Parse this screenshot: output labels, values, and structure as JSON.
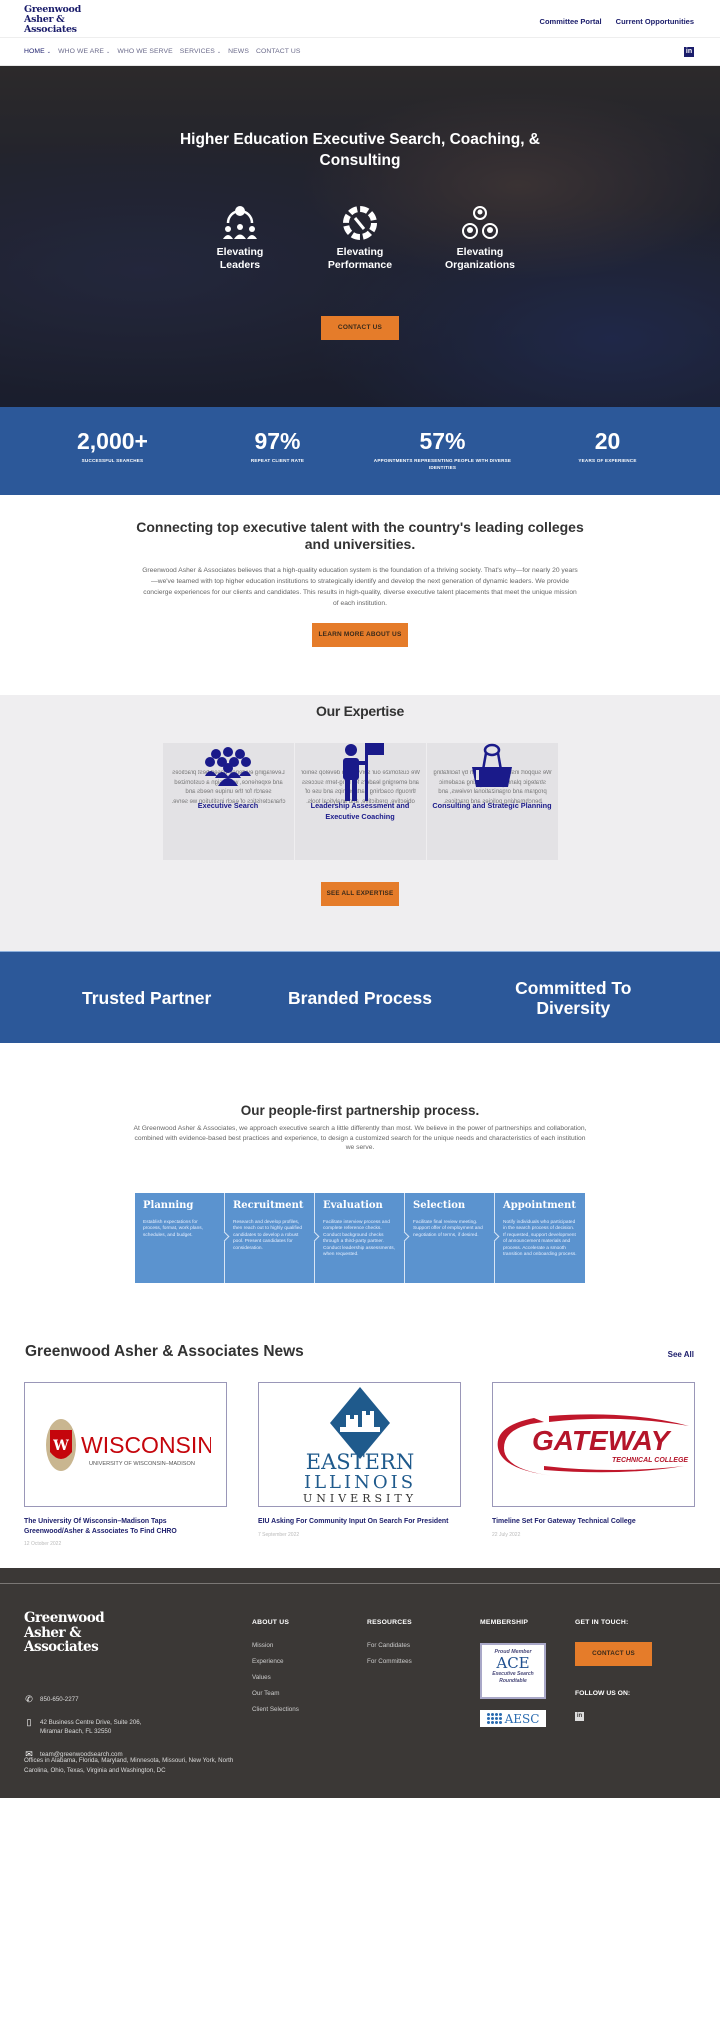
{
  "header": {
    "logo_lines": [
      "Greenwood",
      "Asher &",
      "Associates"
    ],
    "top_links": [
      "Committee Portal",
      "Current Opportunities"
    ],
    "nav": [
      {
        "label": "HOME",
        "dropdown": true,
        "active": true
      },
      {
        "label": "WHO WE ARE",
        "dropdown": true
      },
      {
        "label": "WHO WE SERVE",
        "dropdown": false
      },
      {
        "label": "SERVICES",
        "dropdown": true
      },
      {
        "label": "NEWS",
        "dropdown": false
      },
      {
        "label": "CONTACT US",
        "dropdown": false
      }
    ],
    "social_icon": "linkedin-icon",
    "social_glyph": "in",
    "chevron_glyph": "⌄"
  },
  "hero": {
    "title": "Higher Education Executive Search, Coaching, & Consulting",
    "pillars": [
      {
        "label": "Elevating Leaders",
        "icon": "leaders-icon"
      },
      {
        "label": "Elevating Performance",
        "icon": "gauge-icon"
      },
      {
        "label": "Elevating Organizations",
        "icon": "organization-icon"
      }
    ],
    "cta": "CONTACT US"
  },
  "stats": [
    {
      "value": "2,000+",
      "caption": "SUCCESSFUL SEARCHES"
    },
    {
      "value": "97%",
      "caption": "REPEAT CLIENT RATE"
    },
    {
      "value": "57%",
      "caption": "APPOINTMENTS REPRESENTING PEOPLE WITH DIVERSE IDENTITIES"
    },
    {
      "value": "20",
      "caption": "YEARS OF EXPERIENCE"
    }
  ],
  "intro": {
    "heading": "Connecting top executive talent with the country's leading colleges and universities.",
    "body": "Greenwood Asher & Associates believes that a high-quality education system is the foundation of a thriving society. That's why—for nearly 20 years—we've teamed with top higher education institutions to strategically identify and develop the next generation of dynamic leaders. We provide concierge experiences for our clients and candidates. This results in high-quality, diverse executive talent placements that meet the unique mission of each institution.",
    "cta": "LEARN MORE ABOUT US"
  },
  "expertise": {
    "heading": "Our Expertise",
    "cards": [
      {
        "title": "Executive Search",
        "icon": "group-icon",
        "back": "Leveraging evidence-based best practices and experience, we design a customized search for the unique needs and characteristics of each institution we serve."
      },
      {
        "title": "Leadership Assessment and Executive Coaching",
        "icon": "flag-person-icon",
        "back": "We customize our services to develop senior and emerging leaders for long-term success through coaching partnerships and use of objective, predictive, and analytical tools."
      },
      {
        "title": "Consulting and Strategic Planning",
        "icon": "binder-clip-icon",
        "back": "We support institutional growth by facilitating strategic planning, conducting academic program and organizational reviews, and benchmarking policies and practices."
      }
    ],
    "cta": "SEE ALL EXPERTISE"
  },
  "values": [
    "Trusted Partner",
    "Branded Process",
    "Committed To Diversity"
  ],
  "process": {
    "heading": "Our people-first partnership process.",
    "body": "At Greenwood Asher & Associates, we approach executive search a little differently than most. We believe in the power of partnerships and collaboration, combined with evidence-based best practices and experience, to design a customized search for the unique needs and characteristics of each institution we serve.",
    "steps": [
      {
        "title": "Planning",
        "desc": "Establish expectations for process, format, work plans, schedules, and budget."
      },
      {
        "title": "Recruitment",
        "desc": "Research and develop profiles, then reach out to highly qualified candidates to develop a robust pool. Present candidates for consideration."
      },
      {
        "title": "Evaluation",
        "desc": "Facilitate interview process and complete reference checks. Conduct background checks through a third-party partner. Conduct leadership assessments, when requested."
      },
      {
        "title": "Selection",
        "desc": "Facilitate final review meeting. Support offer of employment and negotiation of terms, if desired."
      },
      {
        "title": "Appointment",
        "desc": "Notify individuals who participated in the search process of decision. If requested, support development of announcement materials and process. Accelerate a smooth transition and onboarding process."
      }
    ]
  },
  "news": {
    "heading": "Greenwood Asher & Associates News",
    "see_all": "See All",
    "items": [
      {
        "title": "The University Of Wisconsin–Madison Taps Greenwood/Asher & Associates To Find CHRO",
        "date": "12 October 2022",
        "logo": {
          "main": "WISCONSIN",
          "sub": "UNIVERSITY OF WISCONSIN–MADISON"
        }
      },
      {
        "title": "EIU Asking For Community Input On Search For President",
        "date": "7 September 2022",
        "logo": {
          "l1": "EASTERN",
          "l2": "ILLINOIS",
          "l3": "UNIVERSITY"
        }
      },
      {
        "title": "Timeline Set For Gateway Technical College",
        "date": "22 July 2022",
        "logo": {
          "main": "GATEWAY",
          "sub": "TECHNICAL COLLEGE"
        }
      }
    ]
  },
  "footer": {
    "logo_lines": [
      "Greenwood",
      "Asher &",
      "Associates"
    ],
    "phone": "850-650-2277",
    "address_1": "42 Business Centre Drive, Suite 206,",
    "address_2": "Miramar Beach, FL 32550",
    "email": "team@greenwoodsearch.com",
    "offices": "Offices in Alabama, Florida, Maryland, Minnesota, Missouri, New York, North Carolina, Ohio, Texas, Virginia and Washington, DC",
    "about": {
      "heading": "ABOUT US",
      "links": [
        "Mission",
        "Experience",
        "Values",
        "Our Team",
        "Client Selections"
      ]
    },
    "resources": {
      "heading": "RESOURCES",
      "links": [
        "For Candidates",
        "For Committees"
      ]
    },
    "membership": {
      "heading": "MEMBERSHIP",
      "ace_top": "Proud Member",
      "ace_logo": "ACE",
      "ace_bottom_1": "Executive Search",
      "ace_bottom_2": "Roundtable",
      "aesc": "AESC"
    },
    "contact": {
      "heading": "GET IN TOUCH:",
      "cta": "CONTACT US",
      "follow": "FOLLOW US ON:",
      "social_glyph": "in"
    }
  },
  "colors": {
    "navy": "#1b1d6b",
    "blue": "#2c5899",
    "orange": "#e57c2a",
    "step_blue": "#5b93cf",
    "footer": "#3b3836"
  }
}
